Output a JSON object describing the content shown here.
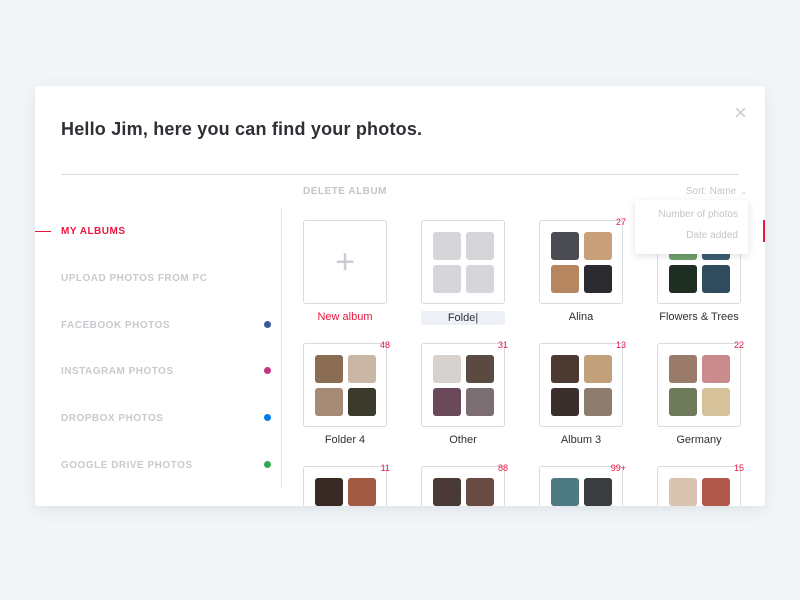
{
  "header": {
    "title": "Hello Jim, here you can find your photos.",
    "close_label": "×"
  },
  "toolbar": {
    "delete_album": "DELETE ALBUM",
    "sort_label": "Sort: Name",
    "sort_chevron": "⌄",
    "sort_options": [
      "Number of photos",
      "Date added"
    ]
  },
  "sidebar": {
    "items": [
      {
        "label": "MY ALBUMS",
        "active": true
      },
      {
        "label": "UPLOAD PHOTOS FROM PC"
      },
      {
        "label": "FACEBOOK PHOTOS",
        "dot_color": "#3b5998"
      },
      {
        "label": "INSTAGRAM PHOTOS",
        "dot_color": "#c13584"
      },
      {
        "label": "DROPBOX PHOTOS",
        "dot_color": "#007ee5"
      },
      {
        "label": "GOOGLE DRIVE PHOTOS",
        "dot_color": "#34a853"
      }
    ]
  },
  "albums": [
    {
      "name": "New album",
      "count": "",
      "type": "new"
    },
    {
      "name": "Folde|",
      "count": "",
      "type": "placeholder"
    },
    {
      "name": "Alina",
      "count": "27"
    },
    {
      "name": "Flowers & Trees",
      "count": ""
    },
    {
      "name": "Folder 4",
      "count": "48"
    },
    {
      "name": "Other",
      "count": "31"
    },
    {
      "name": "Album 3",
      "count": "13"
    },
    {
      "name": "Germany",
      "count": "22"
    },
    {
      "name": "",
      "count": "11"
    },
    {
      "name": "",
      "count": "88"
    },
    {
      "name": "",
      "count": "99+"
    },
    {
      "name": "",
      "count": "15"
    }
  ],
  "colors": {
    "accent": "#e8173f",
    "muted_text": "#c2c5ca",
    "dark_text": "#2f3035"
  }
}
